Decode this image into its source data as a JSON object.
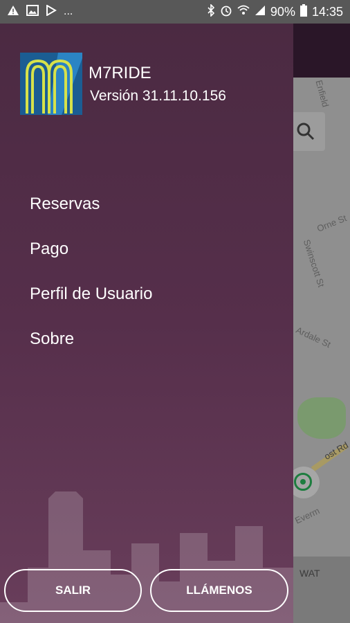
{
  "status_bar": {
    "left_icons": [
      "warning-icon",
      "image-icon",
      "play-store-icon",
      "more-dots-icon"
    ],
    "more": "...",
    "battery": "90%",
    "time": "14:35",
    "right_icons": [
      "bluetooth-icon",
      "alarm-icon",
      "wifi-icon",
      "signal-icon",
      "battery-icon"
    ]
  },
  "drawer": {
    "app_name": "M7RIDE",
    "version": "Versión 31.11.10.156",
    "menu": [
      {
        "label": "Reservas"
      },
      {
        "label": "Pago"
      },
      {
        "label": "Perfil de Usuario"
      },
      {
        "label": "Sobre"
      }
    ],
    "buttons": {
      "exit": "SALIR",
      "call": "LLÁMENOS"
    }
  },
  "map": {
    "streets": [
      "Enfield",
      "Orne St",
      "Swinscott St",
      "Ardale St",
      "ost Rd",
      "Everm"
    ],
    "label_wat": "WAT"
  }
}
